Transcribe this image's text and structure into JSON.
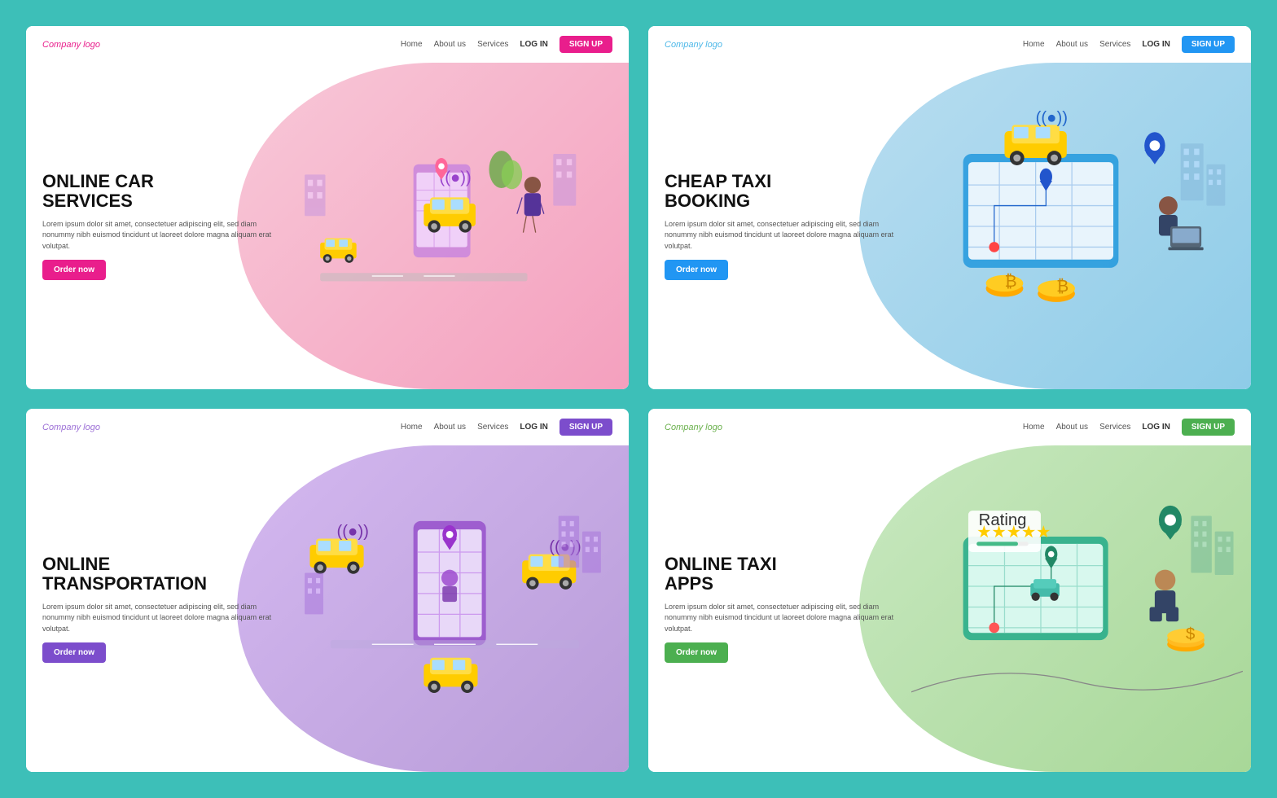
{
  "cards": [
    {
      "id": "card-1",
      "theme": "pink",
      "logo": "Company logo",
      "nav": [
        "Home",
        "About us",
        "Services"
      ],
      "login": "LOG IN",
      "signup": "SIGN UP",
      "title": "ONLINE CAR\nSERVICES",
      "desc": "Lorem ipsum dolor sit amet, consectetuer adipiscing elit, sed diam nonummy nibh euismod tincidunt ut laoreet dolore magna aliquam erat volutpat.",
      "button": "Order now",
      "blob": "pink"
    },
    {
      "id": "card-2",
      "theme": "blue",
      "logo": "Company logo",
      "nav": [
        "Home",
        "About us",
        "Services"
      ],
      "login": "LOG IN",
      "signup": "SIGN UP",
      "title": "CHEAP TAXI\nBOOKING",
      "desc": "Lorem ipsum dolor sit amet, consectetuer adipiscing elit, sed diam nonummy nibh euismod tincidunt ut laoreet dolore magna aliquam erat volutpat.",
      "button": "Order now",
      "blob": "blue"
    },
    {
      "id": "card-3",
      "theme": "purple",
      "logo": "Company logo",
      "nav": [
        "Home",
        "About us",
        "Services"
      ],
      "login": "LOG IN",
      "signup": "SIGN UP",
      "title": "ONLINE\nTRANSPORTATION",
      "desc": "Lorem ipsum dolor sit amet, consectetuer adipiscing elit, sed diam nonummy nibh euismod tincidunt ut laoreet dolore magna aliquam erat volutpat.",
      "button": "Order now",
      "blob": "purple"
    },
    {
      "id": "card-4",
      "theme": "green",
      "logo": "Company logo",
      "nav": [
        "Home",
        "About us",
        "Services"
      ],
      "login": "LOG IN",
      "signup": "SIGN UP",
      "title": "ONLINE TAXI\nAPPS",
      "desc": "Lorem ipsum dolor sit amet, consectetuer adipiscing elit, sed diam nonummy nibh euismod tincidunt ut laoreet dolore magna aliquam erat volutpat.",
      "button": "Order now",
      "blob": "green"
    }
  ],
  "background_color": "#3dbfb8"
}
